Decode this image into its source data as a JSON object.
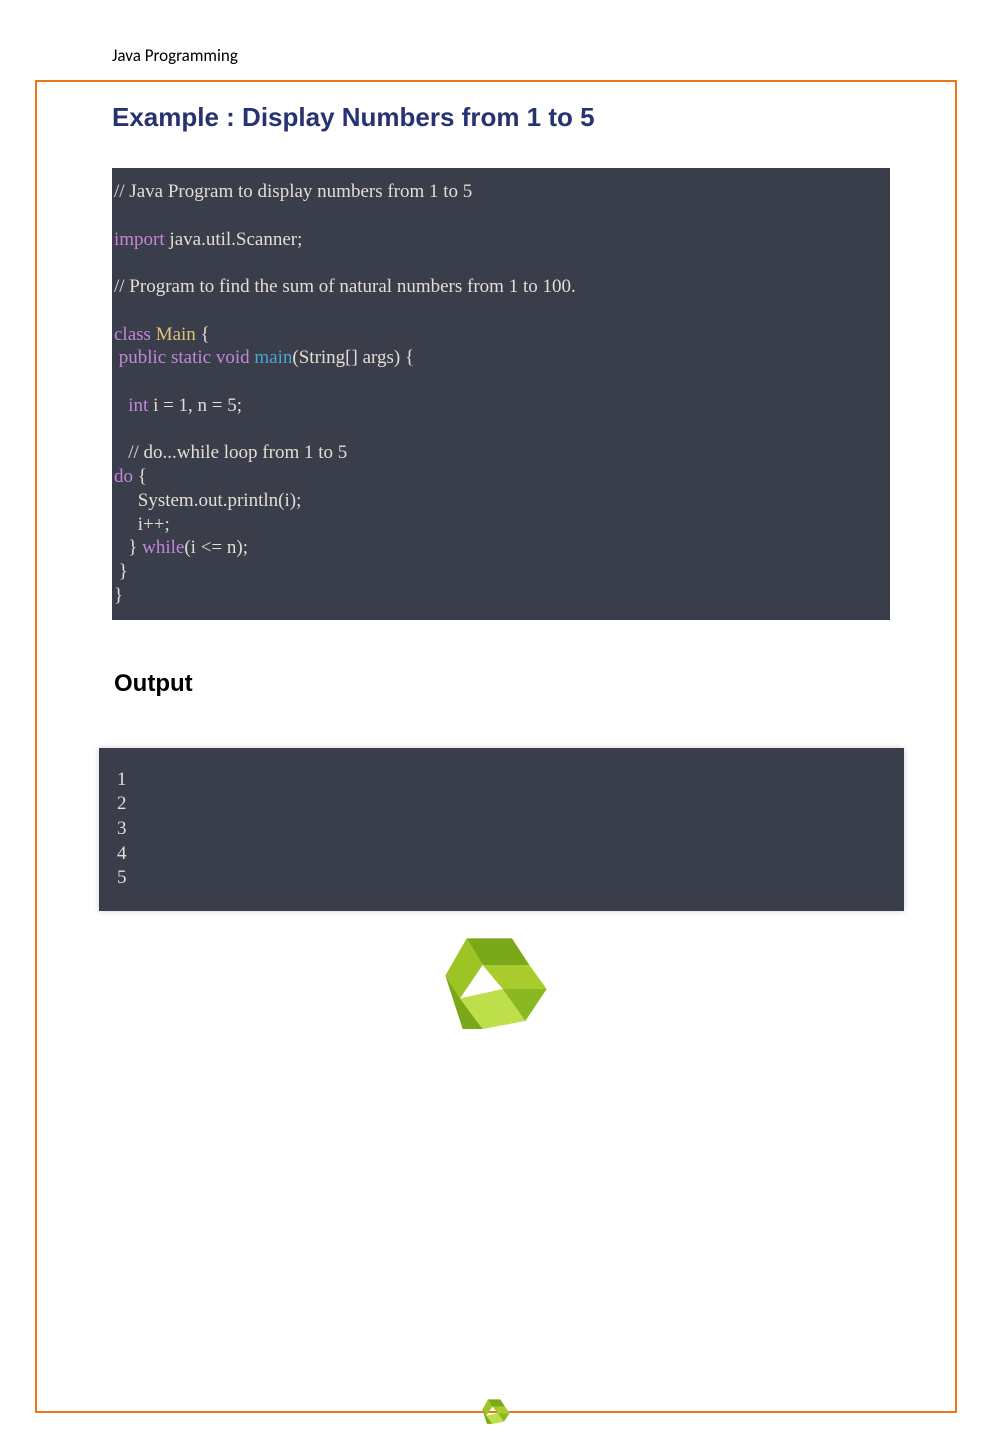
{
  "page_header": "Java Programming",
  "example_heading": "Example : Display Numbers from 1 to 5",
  "code": {
    "l1_comment": "// Java Program to display numbers from 1 to 5",
    "l2_import_kw": "import",
    "l2_rest": " java.util.Scanner;",
    "l3_comment": "// Program to find the sum of natural numbers from 1 to 100.",
    "l4_class_kw": "class",
    "l4_sp": " ",
    "l4_classname": "Main",
    "l4_rest": " {",
    "l5_indent": " ",
    "l5_public": "public",
    "l5_sp1": " ",
    "l5_static": "static",
    "l5_sp2": " ",
    "l5_void": "void",
    "l5_sp3": " ",
    "l5_main": "main",
    "l5_rest": "(String[] args) {",
    "l6_indent": "   ",
    "l6_int": "int",
    "l6_rest": " i = 1, n = 5;",
    "l7_comment": "   // do...while loop from 1 to 5",
    "l8_do": "do",
    "l8_rest": " {",
    "l9": "     System.out.println(i);",
    "l10": "     i++;",
    "l11_indent": "   } ",
    "l11_while": "while",
    "l11_rest": "(i <= n);",
    "l12": " }",
    "l13": "}"
  },
  "output_heading": "Output",
  "output": {
    "l1": "1",
    "l2": "2",
    "l3": "3",
    "l4": "4",
    "l5": "5"
  }
}
